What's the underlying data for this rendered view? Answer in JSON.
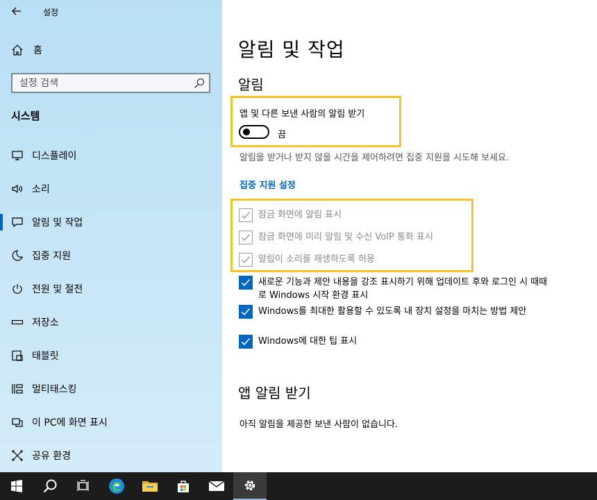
{
  "window": {
    "title": "설정"
  },
  "sidebar": {
    "home_label": "홈",
    "search_placeholder": "설정 검색",
    "section_title": "시스템",
    "items": [
      {
        "label": "디스플레이",
        "icon": "monitor-icon"
      },
      {
        "label": "소리",
        "icon": "speaker-icon"
      },
      {
        "label": "알림 및 작업",
        "icon": "notification-icon",
        "active": true
      },
      {
        "label": "집중 지원",
        "icon": "moon-icon"
      },
      {
        "label": "전원 및 절전",
        "icon": "power-icon"
      },
      {
        "label": "저장소",
        "icon": "storage-icon"
      },
      {
        "label": "태블릿",
        "icon": "tablet-icon"
      },
      {
        "label": "멀티태스킹",
        "icon": "multitasking-icon"
      },
      {
        "label": "이 PC에 화면 표시",
        "icon": "project-icon"
      },
      {
        "label": "공유 환경",
        "icon": "shared-icon"
      }
    ]
  },
  "main": {
    "title": "알림 및 작업",
    "notifications_heading": "알림",
    "toggle_label": "앱 및 다른 보낸 사람의 알림 받기",
    "toggle_state": "끔",
    "toggle_on": false,
    "description": "알림을 받거나 받지 않을 시간을 제어하려면 집중 지원을 시도해 보세요.",
    "focus_link": "집중 지원 설정",
    "disabled_options": [
      "잠금 화면에 알림 표시",
      "잠금 화면에 미리 알림 및 수신 VoIP 통화 표시",
      "알림이 소리를 재생하도록 허용"
    ],
    "options": [
      "새로운 기능과 제안 내용을 강조 표시하기 위해 업데이트 후와 로그인 시 때때로 Windows 시작 환경 표시",
      "Windows를 최대한 활용할 수 있도록 내 장치 설정을 마치는 방법 제안",
      "Windows에 대한 팁 표시"
    ],
    "app_notifications_heading": "앱 알림 받기",
    "no_senders_text": "아직 알림을 제공한 보낸 사람이 없습니다."
  },
  "taskbar": {
    "icons": [
      "windows-start-icon",
      "search-icon",
      "task-view-icon",
      "edge-icon",
      "file-explorer-icon",
      "store-icon",
      "mail-icon",
      "settings-icon"
    ]
  },
  "colors": {
    "accent": "#0067c0",
    "highlight": "#f6c324",
    "taskbar": "#1c1c1c"
  }
}
